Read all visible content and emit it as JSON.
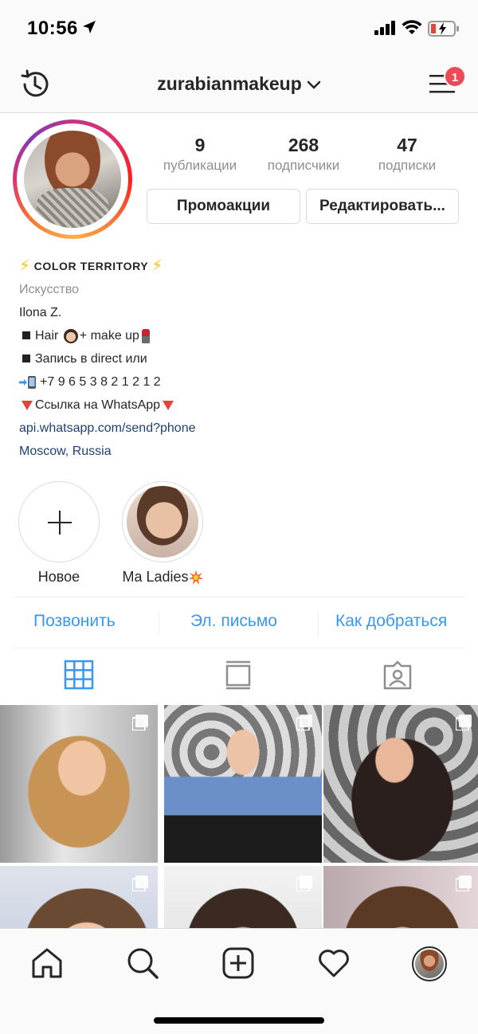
{
  "status_bar": {
    "time": "10:56"
  },
  "header": {
    "username": "zurabianmakeup",
    "notification_count": "1"
  },
  "profile": {
    "stats": [
      {
        "value": "9",
        "label": "публикации"
      },
      {
        "value": "268",
        "label": "подписчики"
      },
      {
        "value": "47",
        "label": "подписки"
      }
    ],
    "buttons": {
      "promo": "Промоакции",
      "edit": "Редактировать..."
    }
  },
  "bio": {
    "title": "COLOR TERRITORY",
    "category": "Искусство",
    "name": "Ilona Z.",
    "line_hair_a": "Hair",
    "line_hair_b": "+ make up",
    "line_booking": "Запись в direct или",
    "phone": "+7 9 6 5 3 8 2 1 2 1 2",
    "whatsapp_text": "Ссылка на WhatsApp",
    "link": "api.whatsapp.com/send?phone",
    "location": "Moscow, Russia"
  },
  "highlights": [
    {
      "label": "Новое"
    },
    {
      "label": "Ma Ladies"
    }
  ],
  "contact": {
    "call": "Позвонить",
    "email": "Эл. письмо",
    "directions": "Как добраться"
  },
  "tabs": {
    "active": "grid"
  },
  "colors": {
    "accent": "#3897f0",
    "badge": "#ed4956",
    "link": "#1c3f73",
    "muted": "#8e8e8e"
  }
}
